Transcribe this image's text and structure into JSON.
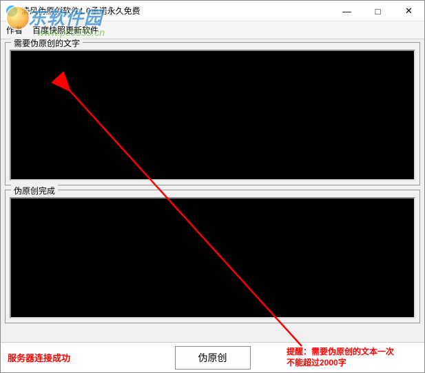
{
  "titlebar": {
    "title": "清风伪原创软件1.0承诺永久免费"
  },
  "toolbar": {
    "author": "作者",
    "update": "百度快照更新软件"
  },
  "groups": {
    "input_label": "需要伪原创的文字",
    "output_label": "伪原创完成"
  },
  "footer": {
    "status": "服务器连接成功",
    "button": "伪原创",
    "hint_line1": "提醒：需要伪原创的文本一次",
    "hint_line2": "不能超过2000字"
  },
  "watermark": {
    "text": "河东软件园",
    "url": "www.pc0359.cn"
  },
  "window_controls": {
    "minimize": "—",
    "maximize": "□",
    "close": "✕"
  }
}
